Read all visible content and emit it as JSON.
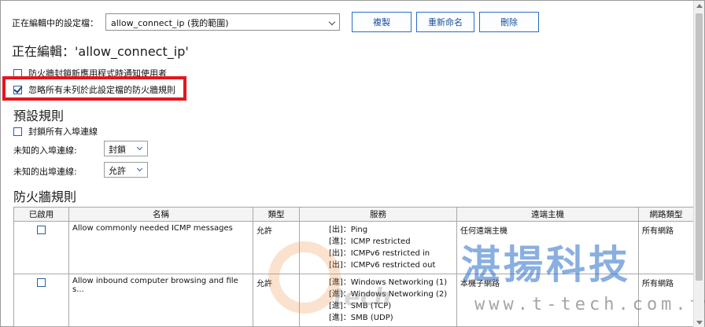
{
  "profile_bar": {
    "label": "正在編輯中的設定檔：",
    "selected_profile": "allow_connect_ip (我的範圍)",
    "copy_label": "複製",
    "rename_label": "重新命名",
    "delete_label": "刪除"
  },
  "editing_heading": "正在編輯：'allow_connect_ip'",
  "options": {
    "notify_blocked": {
      "label": "防火牆封鎖新應用程式時通知使用者",
      "checked": false
    },
    "ignore_unlisted": {
      "label": "忽略所有未列於此設定檔的防火牆規則",
      "checked": true
    }
  },
  "default_rules": {
    "heading": "預設規則",
    "block_all_inbound": {
      "label": "封鎖所有入埠連線",
      "checked": false
    },
    "unknown_inbound": {
      "label": "未知的入埠連線:",
      "value": "封鎖"
    },
    "unknown_outbound": {
      "label": "未知的出埠連線:",
      "value": "允許"
    }
  },
  "firewall_rules": {
    "heading": "防火牆規則",
    "columns": [
      "已啟用",
      "名稱",
      "類型",
      "服務",
      "遠端主機",
      "網路類型"
    ],
    "rows": [
      {
        "enabled": false,
        "name": "Allow commonly needed ICMP messages",
        "type": "允許",
        "services": [
          "[出]：Ping",
          "[進]：ICMP restricted",
          "[出]：ICMPv6 restricted in",
          "[出]：ICMPv6 restricted out"
        ],
        "remote_host": "任何遠端主機",
        "network_type": "所有網路"
      },
      {
        "enabled": false,
        "name": "Allow inbound computer browsing and file s...",
        "type": "允許",
        "services": [
          "[進]：Windows Networking (1)",
          "[進]：Windows Networking (2)",
          "[進]：SMB (TCP)",
          "[進]：SMB (UDP)"
        ],
        "remote_host": "本機子網路",
        "network_type": "所有網路"
      }
    ]
  },
  "watermark": {
    "brand": "湛揚科技",
    "url": "www.t-tech.com.tw",
    "mark": "tech"
  },
  "colors": {
    "accent_blue": "#2a6cc4",
    "highlight_red": "#e3161f"
  }
}
